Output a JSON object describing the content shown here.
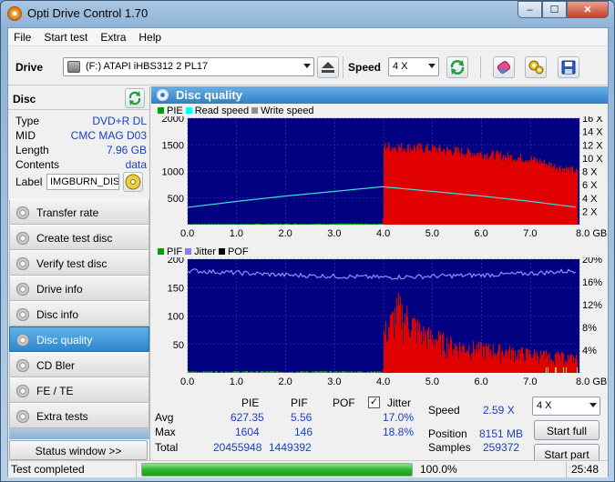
{
  "window": {
    "title": "Opti Drive Control 1.70",
    "minimize": "–",
    "maximize": "☐",
    "close": "✕"
  },
  "menu": [
    "File",
    "Start test",
    "Extra",
    "Help"
  ],
  "toolbar": {
    "drive_label": "Drive",
    "drive_value": "(F:)   ATAPI iHBS312   2 PL17",
    "speed_label": "Speed",
    "speed_value": "4 X",
    "icons": [
      "eject-icon",
      "refresh-icon",
      "eraser-icon",
      "settings-icon",
      "save-icon"
    ]
  },
  "disc": {
    "title": "Disc",
    "rows": [
      {
        "key": "Type",
        "value": "DVD+R DL"
      },
      {
        "key": "MID",
        "value": "CMC MAG D03"
      },
      {
        "key": "Length",
        "value": "7.96 GB"
      },
      {
        "key": "Contents",
        "value": "data"
      }
    ],
    "label_key": "Label",
    "label_value": "IMGBURN_DIS"
  },
  "nav": [
    {
      "label": "Transfer rate",
      "active": false
    },
    {
      "label": "Create test disc",
      "active": false
    },
    {
      "label": "Verify test disc",
      "active": false
    },
    {
      "label": "Drive info",
      "active": false
    },
    {
      "label": "Disc info",
      "active": false
    },
    {
      "label": "Disc quality",
      "active": true
    },
    {
      "label": "CD Bler",
      "active": false
    },
    {
      "label": "FE / TE",
      "active": false
    },
    {
      "label": "Extra tests",
      "active": false
    }
  ],
  "status_window_label": "Status window >>",
  "panel_title": "Disc quality",
  "chart_data": [
    {
      "type": "bar",
      "title": "PIE / Read speed",
      "legend": [
        {
          "name": "PIE",
          "color": "#00a000"
        },
        {
          "name": "Read speed",
          "color": "#00ffff"
        },
        {
          "name": "Write speed",
          "color": "#909090"
        }
      ],
      "x_ticks": [
        "0.0",
        "1.0",
        "2.0",
        "3.0",
        "4.0",
        "5.0",
        "6.0",
        "7.0",
        "8.0 GB"
      ],
      "xlim": [
        0,
        8
      ],
      "y_left_ticks": [
        "500",
        "1000",
        "1500",
        "2000"
      ],
      "ylim_left": [
        0,
        2000
      ],
      "y_right_ticks": [
        "2 X",
        "4 X",
        "6 X",
        "8 X",
        "10 X",
        "12 X",
        "14 X",
        "16 X"
      ],
      "ylim_right": [
        0,
        16
      ],
      "series": [
        {
          "name": "PIE",
          "description": "near zero until 3.98 GB; then dense ~1500-1600 dropping to ~1000 at 8 GB",
          "x": [
            0,
            1,
            2,
            3,
            3.98,
            4.0,
            5,
            6,
            7,
            7.5,
            7.96
          ],
          "values": [
            10,
            10,
            15,
            15,
            15,
            1550,
            1500,
            1400,
            1300,
            1150,
            1050
          ]
        },
        {
          "name": "Read speed",
          "x": [
            0,
            1,
            2,
            3,
            3.98,
            5,
            6,
            7,
            7.96
          ],
          "values": [
            2.6,
            3.5,
            4.3,
            5.0,
            5.7,
            5.0,
            4.3,
            3.5,
            2.6
          ]
        }
      ]
    },
    {
      "type": "bar",
      "title": "PIF / Jitter / POF",
      "legend": [
        {
          "name": "PIF",
          "color": "#00a000"
        },
        {
          "name": "Jitter",
          "color": "#8080ff"
        },
        {
          "name": "POF",
          "color": "#000000"
        }
      ],
      "x_ticks": [
        "0.0",
        "1.0",
        "2.0",
        "3.0",
        "4.0",
        "5.0",
        "6.0",
        "7.0",
        "8.0 GB"
      ],
      "xlim": [
        0,
        8
      ],
      "y_left_ticks": [
        "50",
        "100",
        "150",
        "200"
      ],
      "ylim_left": [
        0,
        200
      ],
      "y_right_ticks": [
        "4%",
        "8%",
        "12%",
        "16%",
        "20%"
      ],
      "ylim_right": [
        0,
        20
      ],
      "series": [
        {
          "name": "PIF",
          "x": [
            0,
            3.98,
            4.0,
            4.3,
            4.8,
            5.5,
            6.5,
            7.5,
            7.96
          ],
          "values": [
            2,
            2,
            80,
            130,
            80,
            55,
            45,
            35,
            30
          ]
        },
        {
          "name": "Jitter",
          "x": [
            0,
            1,
            2,
            3,
            4,
            5,
            6,
            7,
            7.96
          ],
          "values": [
            18.0,
            17.6,
            17.2,
            17.0,
            16.8,
            17.0,
            17.2,
            17.5,
            18.0
          ]
        }
      ]
    }
  ],
  "stats": {
    "headers": [
      "PIE",
      "PIF",
      "POF",
      "Jitter"
    ],
    "jitter_checked": true,
    "rows": [
      {
        "label": "Avg",
        "pie": "627.35",
        "pif": "5.56",
        "pof": "",
        "jitter": "17.0%"
      },
      {
        "label": "Max",
        "pie": "1604",
        "pif": "146",
        "pof": "",
        "jitter": "18.8%"
      },
      {
        "label": "Total",
        "pie": "20455948",
        "pif": "1449392",
        "pof": "",
        "jitter": ""
      }
    ],
    "speed_label": "Speed",
    "speed_value": "2.59 X",
    "position_label": "Position",
    "position_value": "8151 MB",
    "samples_label": "Samples",
    "samples_value": "259372",
    "speed_select": "4 X",
    "start_full": "Start full",
    "start_part": "Start part"
  },
  "statusbar": {
    "message": "Test completed",
    "progress": 100.0,
    "progress_text": "100.0%",
    "time": "25:48"
  }
}
